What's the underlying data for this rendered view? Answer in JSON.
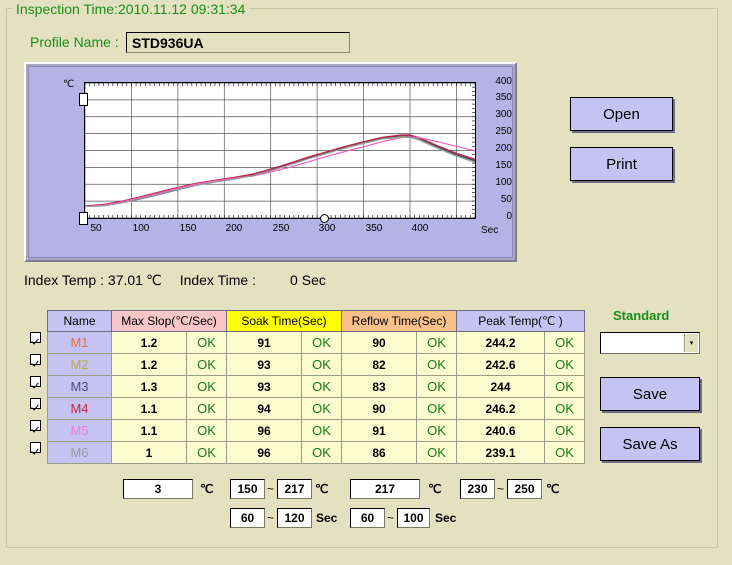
{
  "window": {
    "group_legend": "Inspection Time:2010.11.12  09:31:34",
    "bg_color": "#e3e1c0",
    "accent_green": "#1a8f1a"
  },
  "profile": {
    "label": "Profile Name :",
    "value": "STD936UA"
  },
  "chart": {
    "y_unit": "℃",
    "x_unit": "Sec",
    "y_ticks": [
      "400",
      "350",
      "300",
      "250",
      "200",
      "150",
      "100",
      "50",
      "0"
    ],
    "x_ticks": [
      "50",
      "100",
      "150",
      "200",
      "250",
      "300",
      "350",
      "400"
    ],
    "slider_top_value": "350",
    "slider_bottom_value": "0",
    "cursor_value": "300"
  },
  "chart_data": {
    "type": "line",
    "title": "",
    "xlabel": "Sec",
    "ylabel": "℃",
    "xlim": [
      0,
      420
    ],
    "ylim": [
      0,
      400
    ],
    "grid": true,
    "legend": "none",
    "x": [
      0,
      20,
      40,
      60,
      80,
      100,
      120,
      140,
      160,
      180,
      200,
      220,
      240,
      260,
      280,
      300,
      320,
      340,
      350,
      360,
      380,
      400,
      420
    ],
    "series": [
      {
        "name": "M1",
        "color": "#e8713c",
        "values": [
          35,
          38,
          47,
          60,
          74,
          88,
          100,
          110,
          118,
          128,
          143,
          160,
          178,
          194,
          210,
          224,
          237,
          244,
          244.2,
          236,
          212,
          190,
          172
        ]
      },
      {
        "name": "M2",
        "color": "#a8a23c",
        "values": [
          34,
          37,
          46,
          59,
          73,
          87,
          99,
          109,
          117,
          127,
          142,
          159,
          177,
          193,
          209,
          223,
          236,
          243,
          242.6,
          234,
          209,
          186,
          167
        ]
      },
      {
        "name": "M3",
        "color": "#3c4a6e",
        "values": [
          35,
          37,
          45,
          57,
          70,
          84,
          97,
          107,
          115,
          126,
          142,
          160,
          178,
          195,
          211,
          225,
          238,
          244,
          244.0,
          236,
          211,
          188,
          170
        ]
      },
      {
        "name": "M4",
        "color": "#c4244a",
        "values": [
          36,
          40,
          50,
          63,
          77,
          91,
          103,
          112,
          120,
          130,
          145,
          162,
          180,
          196,
          212,
          226,
          239,
          246,
          246.2,
          238,
          214,
          192,
          174
        ]
      },
      {
        "name": "M5",
        "color": "#ee5fc1",
        "values": [
          34,
          38,
          48,
          60,
          74,
          89,
          101,
          110,
          117,
          124,
          136,
          150,
          166,
          182,
          197,
          211,
          226,
          238,
          240.6,
          238,
          226,
          212,
          199
        ]
      },
      {
        "name": "M6",
        "color": "#9a9a9a",
        "values": [
          34,
          36,
          45,
          58,
          71,
          85,
          97,
          107,
          115,
          125,
          140,
          157,
          175,
          191,
          207,
          221,
          234,
          239,
          239.1,
          231,
          206,
          183,
          165
        ]
      }
    ]
  },
  "index": {
    "temp_label": "Index Temp :",
    "temp_value": "37.01",
    "temp_unit": "℃",
    "time_label": "Index Time :",
    "time_value": "0",
    "time_unit": "Sec"
  },
  "buttons": {
    "open": "Open",
    "print": "Print",
    "save": "Save",
    "save_as": "Save As"
  },
  "standard": {
    "label": "Standard",
    "combo_value": "",
    "combo_arrow": "▾"
  },
  "table": {
    "headers": [
      "Name",
      "Max Slop(℃/Sec)",
      "Soak Time(Sec)",
      "Reflow Time(Sec)",
      "Peak Temp(℃ )"
    ],
    "header_colors": [
      "#c6c3f2",
      "#f8c6c9",
      "#ffff00",
      "#f9c08a",
      "#c6c3f2"
    ],
    "rows": [
      {
        "checked": true,
        "name": "M1",
        "name_color": "#e8713c",
        "slope": "1.2",
        "slope_ok": "OK",
        "soak": "91",
        "soak_ok": "OK",
        "reflow": "90",
        "reflow_ok": "OK",
        "peak": "244.2",
        "peak_ok": "OK"
      },
      {
        "checked": true,
        "name": "M2",
        "name_color": "#b5ae4a",
        "slope": "1.2",
        "slope_ok": "OK",
        "soak": "93",
        "soak_ok": "OK",
        "reflow": "82",
        "reflow_ok": "OK",
        "peak": "242.6",
        "peak_ok": "OK"
      },
      {
        "checked": true,
        "name": "M3",
        "name_color": "#46506e",
        "slope": "1.3",
        "slope_ok": "OK",
        "soak": "93",
        "soak_ok": "OK",
        "reflow": "83",
        "reflow_ok": "OK",
        "peak": "244",
        "peak_ok": "OK"
      },
      {
        "checked": true,
        "name": "M4",
        "name_color": "#c4244a",
        "slope": "1.1",
        "slope_ok": "OK",
        "soak": "94",
        "soak_ok": "OK",
        "reflow": "90",
        "reflow_ok": "OK",
        "peak": "246.2",
        "peak_ok": "OK"
      },
      {
        "checked": true,
        "name": "M5",
        "name_color": "#f07ed0",
        "slope": "1.1",
        "slope_ok": "OK",
        "soak": "96",
        "soak_ok": "OK",
        "reflow": "91",
        "reflow_ok": "OK",
        "peak": "240.6",
        "peak_ok": "OK"
      },
      {
        "checked": true,
        "name": "M6",
        "name_color": "#9a9a9a",
        "slope": "1",
        "slope_ok": "OK",
        "soak": "96",
        "soak_ok": "OK",
        "reflow": "86",
        "reflow_ok": "OK",
        "peak": "239.1",
        "peak_ok": "OK"
      }
    ]
  },
  "params": {
    "slope_limit": "3",
    "slope_unit": "℃",
    "soak_temp_low": "150",
    "soak_temp_high": "217",
    "soak_temp_unit": "℃",
    "soak_time_low": "60",
    "soak_time_high": "120",
    "soak_time_unit": "Sec",
    "reflow_temp": "217",
    "reflow_temp_unit": "℃",
    "reflow_time_low": "60",
    "reflow_time_high": "100",
    "reflow_time_unit": "Sec",
    "peak_low": "230",
    "peak_high": "250",
    "peak_unit": "℃",
    "tilde": "~"
  }
}
